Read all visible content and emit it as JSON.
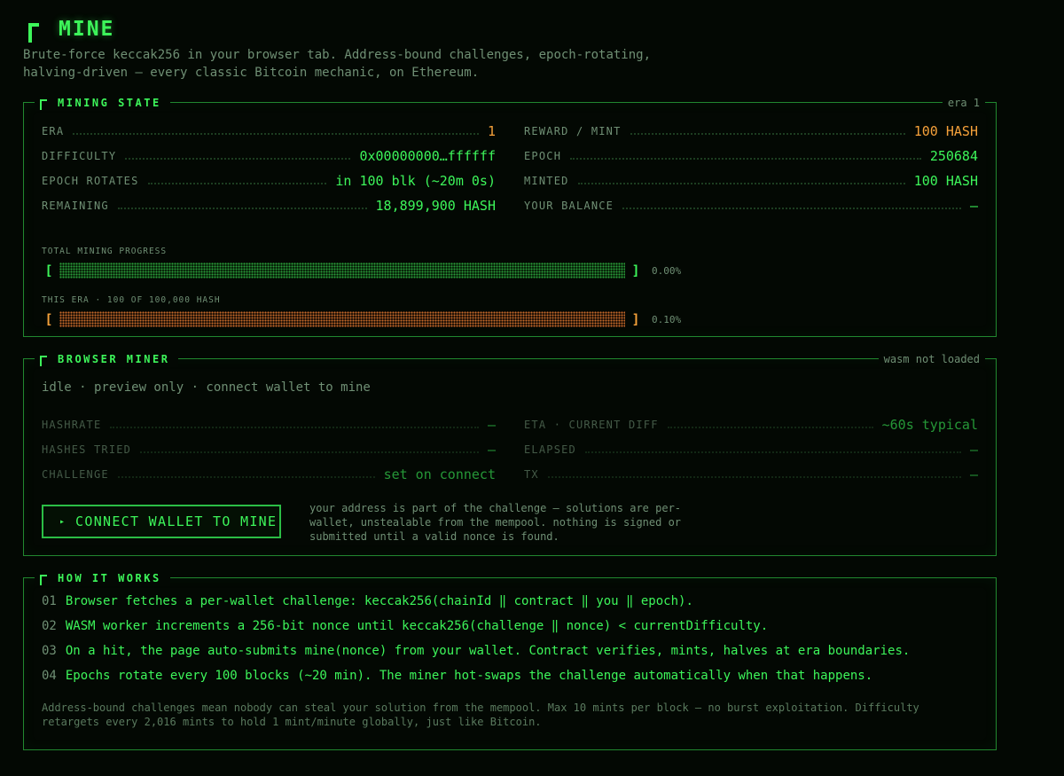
{
  "header": {
    "title": "MINE",
    "tagline": "Brute-force keccak256 in your browser tab. Address-bound challenges, epoch-rotating, halving-driven — every classic Bitcoin mechanic, on Ethereum."
  },
  "mining_state": {
    "title": "MINING STATE",
    "corner_tag": "era 1",
    "left": [
      {
        "key": "ERA",
        "value": "1",
        "color": "#f5a13a"
      },
      {
        "key": "DIFFICULTY",
        "value": "0x00000000…ffffff",
        "color": "#3df55a"
      },
      {
        "key": "EPOCH ROTATES",
        "value": "in 100 blk (~20m 0s)",
        "color": "#3df55a"
      },
      {
        "key": "REMAINING",
        "value": "18,899,900 HASH",
        "color": "#3df55a"
      }
    ],
    "right": [
      {
        "key": "REWARD / MINT",
        "value": "100 HASH",
        "color": "#f5a13a"
      },
      {
        "key": "EPOCH",
        "value": "250684",
        "color": "#3df55a"
      },
      {
        "key": "MINTED",
        "value": "100 HASH",
        "color": "#3df55a"
      },
      {
        "key": "YOUR BALANCE",
        "value": "—",
        "color": "#3df55a"
      }
    ],
    "progress": [
      {
        "label": "TOTAL MINING PROGRESS",
        "percent_text": "0.00%",
        "fraction": 0.0,
        "color": "#3df55a",
        "bracket_open": "[",
        "bracket_close": "]"
      },
      {
        "label": "THIS ERA · 100 OF 100,000 HASH",
        "percent_text": "0.10%",
        "fraction": 0.001,
        "color": "#f5a13a",
        "bracket_open": "[",
        "bracket_close": "]"
      }
    ]
  },
  "browser_miner": {
    "title": "BROWSER MINER",
    "corner_tag": "wasm not loaded",
    "status": "idle · preview only · connect wallet to mine",
    "left": [
      {
        "key": "HASHRATE",
        "value": "—"
      },
      {
        "key": "HASHES TRIED",
        "value": "—"
      },
      {
        "key": "CHALLENGE",
        "value": "set on connect"
      }
    ],
    "right": [
      {
        "key": "ETA · CURRENT DIFF",
        "value": "~60s typical"
      },
      {
        "key": "ELAPSED",
        "value": "—"
      },
      {
        "key": "TX",
        "value": "—"
      }
    ],
    "button_arrow": "▸",
    "button_label": "CONNECT WALLET TO MINE",
    "note": "your address is part of the challenge — solutions are per-wallet, unstealable from the mempool. nothing is signed or submitted until a valid nonce is found."
  },
  "how_it_works": {
    "title": "HOW IT WORKS",
    "steps": [
      {
        "num": "01",
        "text": "Browser fetches a per-wallet challenge: keccak256(chainId ‖ contract ‖ you ‖ epoch)."
      },
      {
        "num": "02",
        "text": "WASM worker increments a 256-bit nonce until keccak256(challenge ‖ nonce) < currentDifficulty."
      },
      {
        "num": "03",
        "text": "On a hit, the page auto-submits mine(nonce) from your wallet. Contract verifies, mints, halves at era boundaries."
      },
      {
        "num": "04",
        "text": "Epochs rotate every 100 blocks (~20 min). The miner hot-swaps the challenge automatically when that happens."
      }
    ],
    "footnote": "Address-bound challenges mean nobody can steal your solution from the mempool. Max 10 mints per block — no burst exploitation. Difficulty retargets every 2,016 mints to hold 1 mint/minute globally, just like Bitcoin."
  },
  "colors": {
    "accent": "#3df55a",
    "warm": "#f5a13a",
    "muted": "#6f8f74",
    "border": "#21872f",
    "background": "#030803"
  }
}
